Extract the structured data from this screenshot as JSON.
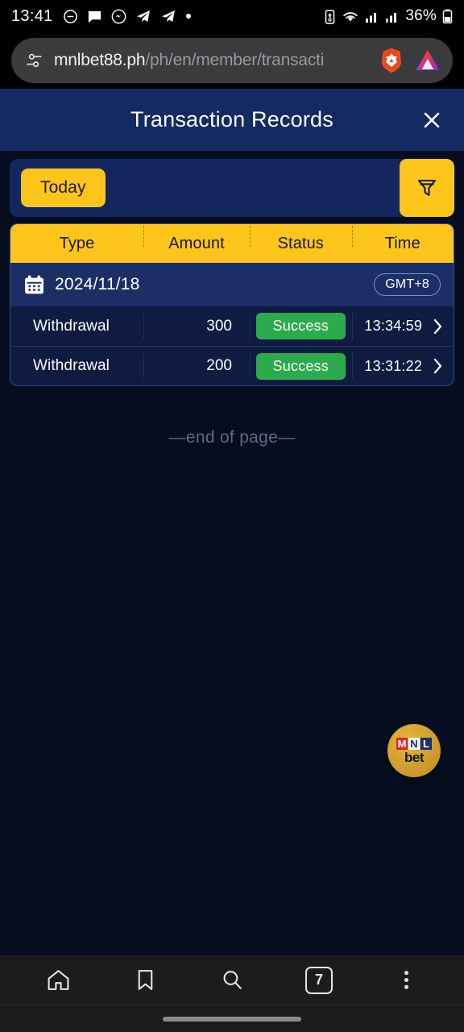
{
  "status_bar": {
    "time": "13:41",
    "battery_percent": "36%",
    "left_icons": [
      "dnd-icon",
      "chat-bubble-icon",
      "messenger-icon",
      "telegram-icon",
      "telegram-icon",
      "dot-icon"
    ],
    "right_icons": [
      "battery-saver-icon",
      "wifi-icon",
      "signal-bars-icon",
      "signal-bars-icon",
      "battery-icon"
    ]
  },
  "browser": {
    "url_domain": "mnlbet88.ph",
    "url_path": "/ph/en/member/transacti",
    "permissions_icon": "page-settings-icon",
    "shield_icon": "brave-shield-icon",
    "rewards_icon": "bat-rewards-icon"
  },
  "header": {
    "title": "Transaction Records",
    "close_label": "✕"
  },
  "filter": {
    "today_label": "Today",
    "filter_icon": "funnel-icon"
  },
  "table": {
    "columns": [
      "Type",
      "Amount",
      "Status",
      "Time"
    ],
    "date_group": {
      "calendar_icon": "calendar-icon",
      "date": "2024/11/18",
      "timezone": "GMT+8"
    },
    "rows": [
      {
        "type": "Withdrawal",
        "amount": "300",
        "status": "Success",
        "time": "13:34:59",
        "chevron": "chevron-right-icon"
      },
      {
        "type": "Withdrawal",
        "amount": "200",
        "status": "Success",
        "time": "13:31:22",
        "chevron": "chevron-right-icon"
      }
    ]
  },
  "end_of_page": "—end of page—",
  "float_logo": {
    "mark_letters": [
      "M",
      "N",
      "L"
    ],
    "word": "bet"
  },
  "bottom_nav": {
    "items": [
      "home-icon",
      "bookmarks-icon",
      "search-icon",
      "tab-switcher",
      "menu-icon"
    ],
    "tab_count": "7"
  },
  "colors": {
    "accent_yellow": "#fec51c",
    "header_navy": "#152a63",
    "page_bg": "#060d1e",
    "success_green": "#2cab4c"
  }
}
